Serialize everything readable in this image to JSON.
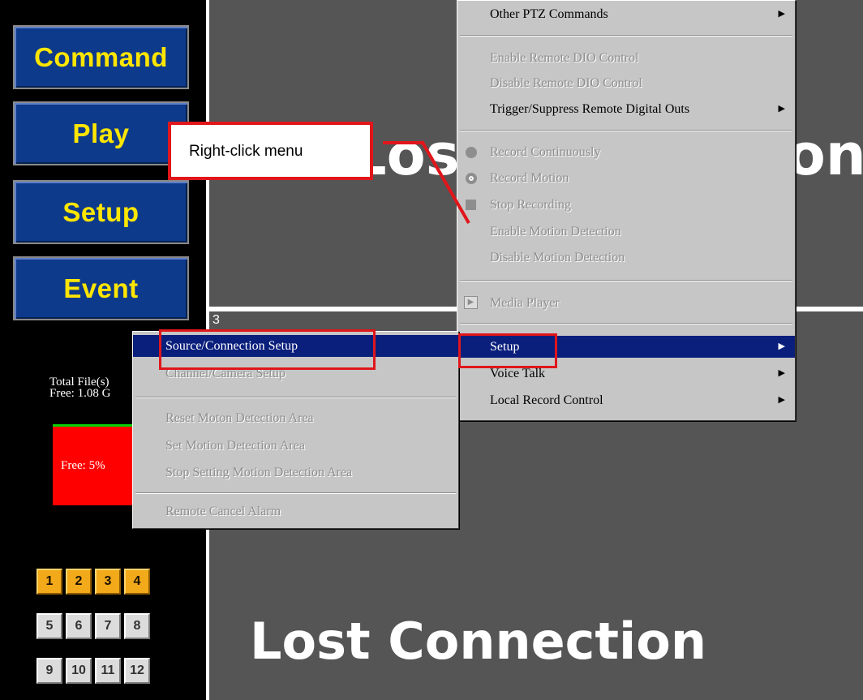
{
  "nav": {
    "command": "Command",
    "play": "Play",
    "setup": "Setup",
    "event": "Event"
  },
  "disk": {
    "total_files": "Total File(s)",
    "free": "Free: 1.08 G",
    "bar_label": "Free: 5%",
    "free_percent": 5
  },
  "channels": {
    "row1": [
      "1",
      "2",
      "3",
      "4"
    ],
    "row2": [
      "5",
      "6",
      "7",
      "8"
    ],
    "row3": [
      "9",
      "10",
      "11",
      "12"
    ]
  },
  "panes": {
    "top_right_text": "Lost Connection",
    "bottom_number": "3",
    "bottom_text": "Lost Connection"
  },
  "callout": {
    "text": "Right-click menu"
  },
  "main_menu": {
    "other_ptz": "Other PTZ Commands",
    "enable_dio": "Enable Remote DIO Control",
    "disable_dio": "Disable Remote DIO Control",
    "trigger_outs": "Trigger/Suppress Remote Digital Outs",
    "record_continuously": "Record Continuously",
    "record_motion": "Record Motion",
    "stop_recording": "Stop Recording",
    "enable_motion": "Enable Motion Detection",
    "disable_motion": "Disable Motion Detection",
    "media_player": "Media Player",
    "setup": "Setup",
    "voice_talk": "Voice Talk",
    "local_record": "Local Record Control"
  },
  "sub_menu": {
    "source_setup": "Source/Connection Setup",
    "channel_setup": "Channel/Camera Setup",
    "reset_motion": "Reset Moton Detection Area",
    "set_motion": "Set Motion Detection Area",
    "stop_motion": "Stop Setting Motion Detection Area",
    "cancel_alarm": "Remote Cancel Alarm"
  }
}
